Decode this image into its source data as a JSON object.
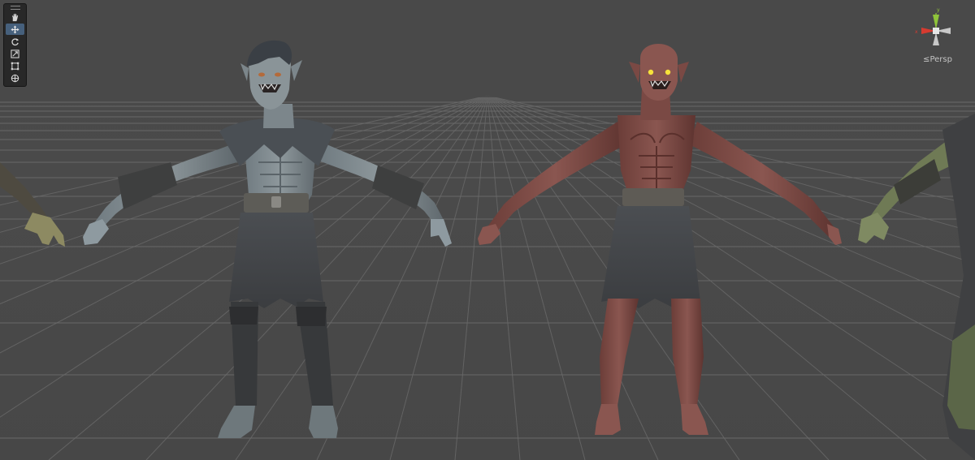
{
  "toolbar": {
    "tools": [
      {
        "name": "hand-tool",
        "icon": "hand-icon",
        "active": false
      },
      {
        "name": "move-tool",
        "icon": "move-icon",
        "active": true
      },
      {
        "name": "rotate-tool",
        "icon": "rotate-icon",
        "active": false
      },
      {
        "name": "scale-tool",
        "icon": "scale-icon",
        "active": false
      },
      {
        "name": "rect-tool",
        "icon": "rect-icon",
        "active": false
      },
      {
        "name": "transform-tool",
        "icon": "transform-icon",
        "active": false
      }
    ]
  },
  "gizmo": {
    "projection_label": "Persp",
    "axis_colors": {
      "x": "#d63b30",
      "y": "#8fc43a",
      "z": "#3a7ad6"
    }
  },
  "scene": {
    "background": "#4a4a4a",
    "grid_color": "#707070"
  }
}
